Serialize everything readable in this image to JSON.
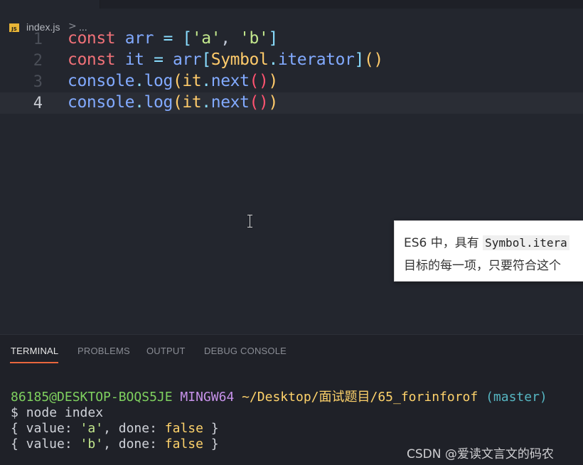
{
  "breadcrumb": {
    "file": "index.js",
    "separator": ">",
    "more": "...",
    "file_icon_text": "JS"
  },
  "editor": {
    "line_numbers": [
      "1",
      "2",
      "3",
      "4"
    ],
    "current_line": 4,
    "lines": {
      "l1": {
        "kw": "const",
        "name": "arr",
        "eq": "=",
        "open": "[",
        "s1": "'a'",
        "comma": ",",
        "s2": "'b'",
        "close": "]"
      },
      "l2": {
        "kw": "const",
        "name": "it",
        "eq": "=",
        "obj": "arr",
        "open": "[",
        "sym": "Symbol",
        "dot": ".",
        "prop": "iterator",
        "close": "]",
        "paren": "()"
      },
      "l3": {
        "obj": "console",
        "dot1": ".",
        "fn": "log",
        "open": "(",
        "arg": "it",
        "dot2": ".",
        "method": "next",
        "inner": "()",
        "close": ")"
      },
      "l4": {
        "obj": "console",
        "dot1": ".",
        "fn": "log",
        "open": "(",
        "arg": "it",
        "dot2": ".",
        "method": "next",
        "inner": "()",
        "close": ")"
      }
    }
  },
  "tooltip": {
    "line1_prefix": "ES6 中，具有 ",
    "line1_code": "Symbol.itera",
    "line2": "目标的每一项，只要符合这个"
  },
  "panel": {
    "tabs": [
      "TERMINAL",
      "PROBLEMS",
      "OUTPUT",
      "DEBUG CONSOLE"
    ],
    "active_tab": "TERMINAL"
  },
  "terminal": {
    "user_host": "86185@DESKTOP-BOQS5JE",
    "shell": "MINGW64",
    "path": "~/Desktop/面试题目/65_forinforof",
    "branch": "(master)",
    "prompt": "$",
    "command": "node index",
    "output": [
      {
        "open": "{ value: ",
        "value": "'a'",
        "mid": ", done: ",
        "done": "false",
        "close": " }"
      },
      {
        "open": "{ value: ",
        "value": "'b'",
        "mid": ", done: ",
        "done": "false",
        "close": " }"
      }
    ]
  },
  "watermark": "CSDN @爱读文言文的码农",
  "colors": {
    "editor_bg": "#23262e",
    "panel_bg": "#1f2128",
    "keyword": "#f07178",
    "identifier": "#82aaff",
    "string": "#c3e88d",
    "active_tab_underline": "#e8663d"
  }
}
